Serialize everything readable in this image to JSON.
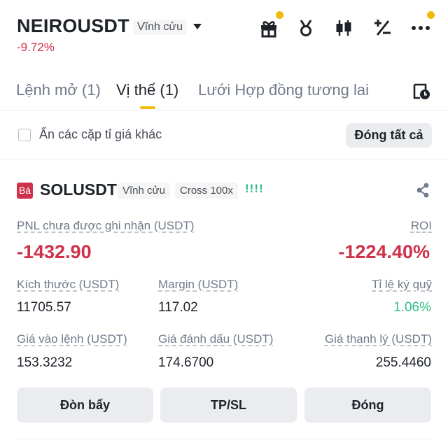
{
  "header": {
    "symbol": "NEIROUSDT",
    "contract_type": "Vĩnh cửu",
    "change": "-9.72%",
    "icons": [
      "gift-icon",
      "medal-icon",
      "candlestick-icon",
      "calculator-icon",
      "more-icon"
    ]
  },
  "tabs": [
    {
      "label": "Lệnh mở (1)",
      "active": false
    },
    {
      "label": "Vị thế (1)",
      "active": true
    },
    {
      "label": "Lưới Hợp đồng tương lai",
      "active": false
    }
  ],
  "filter": {
    "hide_pairs_label": "Ẩn các cặp tỉ giá khác",
    "hide_pairs_checked": false,
    "close_all_label": "Đóng tất cả"
  },
  "position": {
    "side": "Bá",
    "symbol": "SOLUSDT",
    "contract_type": "Vĩnh cửu",
    "margin_mode": "Cross 100x",
    "risk": "!!!!",
    "pnl_label": "PNL chưa được ghi nhận (USDT)",
    "pnl_value": "-1432.90",
    "roi_label": "ROI",
    "roi_value": "-1224.40%",
    "size_label": "Kích thước (USDT)",
    "size_value": "11705.57",
    "margin_label": "Margin (USDT)",
    "margin_value": "117.02",
    "margin_ratio_label": "Tỉ lệ ký quỹ",
    "margin_ratio_value": "1.06%",
    "entry_label": "Giá vào lệnh (USDT)",
    "entry_value": "153.3232",
    "mark_label": "Giá đánh dấu (USDT)",
    "mark_value": "174.6700",
    "liq_label": "Giá thanh lý (USDT)",
    "liq_value": "255.4460",
    "buttons": {
      "leverage": "Đòn bẩy",
      "tpsl": "TP/SL",
      "close": "Đóng"
    }
  },
  "colors": {
    "red": "#cf304a",
    "green": "#2ebd85",
    "accent": "#f0b90b",
    "text": "#1e2329",
    "muted": "#707a8a",
    "button_bg": "#eaecef"
  }
}
